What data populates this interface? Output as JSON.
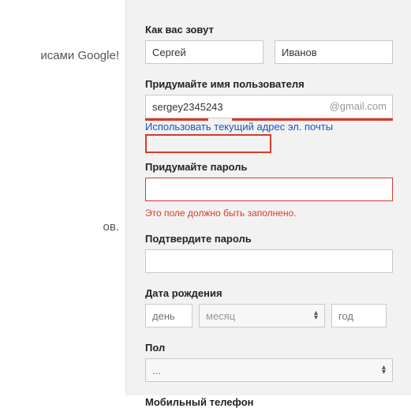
{
  "left": {
    "text1": "исами Google!",
    "text2": "ов."
  },
  "name": {
    "label": "Как вас зовут",
    "first": "Сергей",
    "last": "Иванов"
  },
  "username": {
    "label": "Придумайте имя пользователя",
    "value": "sergey2345243",
    "suffix": "@gmail.com",
    "use_current_link": "Использовать текущий адрес эл. почты"
  },
  "password": {
    "label": "Придумайте пароль",
    "error": "Это поле должно быть заполнено."
  },
  "confirm": {
    "label": "Подтвердите пароль"
  },
  "dob": {
    "label": "Дата рождения",
    "day_placeholder": "день",
    "month_placeholder": "месяц",
    "year_placeholder": "год"
  },
  "gender": {
    "label": "Пол",
    "value": "..."
  },
  "phone": {
    "label": "Мобильный телефон"
  }
}
